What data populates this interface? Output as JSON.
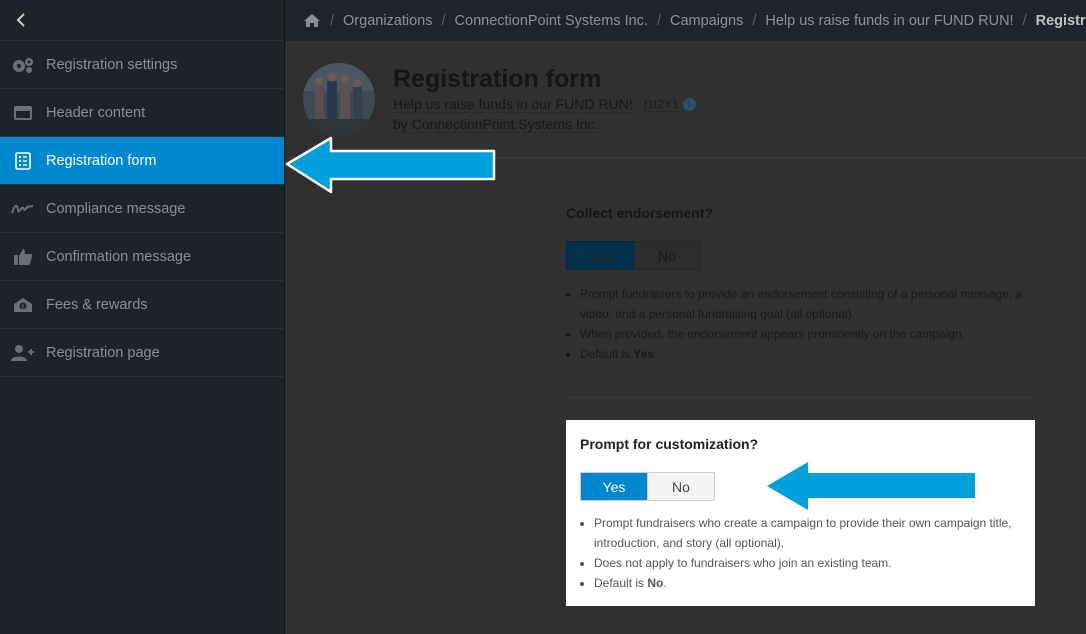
{
  "sidebar": {
    "items": [
      {
        "label": "Registration settings",
        "icon": "gears-icon"
      },
      {
        "label": "Header content",
        "icon": "header-icon"
      },
      {
        "label": "Registration form",
        "icon": "form-list-icon",
        "active": true
      },
      {
        "label": "Compliance message",
        "icon": "signature-icon"
      },
      {
        "label": "Confirmation message",
        "icon": "thumbs-up-icon"
      },
      {
        "label": "Fees & rewards",
        "icon": "money-icon"
      },
      {
        "label": "Registration page",
        "icon": "add-user-icon"
      }
    ]
  },
  "breadcrumb": {
    "items": [
      "Organizations",
      "ConnectionPoint Systems Inc.",
      "Campaigns",
      "Help us raise funds in our FUND RUN!"
    ],
    "current": "Registration"
  },
  "header": {
    "title": "Registration form",
    "campaign": "Help us raise funds in our FUND RUN!",
    "code": "f1t2Y1",
    "org": "by ConnectionPoint Systems Inc."
  },
  "endorsement": {
    "title": "Collect endorsement?",
    "yes": "Yes",
    "no": "No",
    "selected": "Yes",
    "bullets": [
      "Prompt fundraisers to provide an endorsement consisting of a personal message, a video, and a personal fundraising goal (all optional).",
      "When provided, the endorsement appears prominently on the campaign."
    ],
    "default_prefix": "Default is ",
    "default_value": "Yes",
    "default_suffix": "."
  },
  "customization": {
    "title": "Prompt for customization?",
    "yes": "Yes",
    "no": "No",
    "selected": "Yes",
    "bullets": [
      "Prompt fundraisers who create a campaign to provide their own campaign title, introduction, and story (all optional).",
      "Does not apply to fundraisers who join an existing team."
    ],
    "default_prefix": "Default is ",
    "default_value": "No",
    "default_suffix": "."
  },
  "colors": {
    "accent": "#0087cf",
    "arrow": "#00a0dc",
    "sidebar_bg": "#1f2329"
  }
}
